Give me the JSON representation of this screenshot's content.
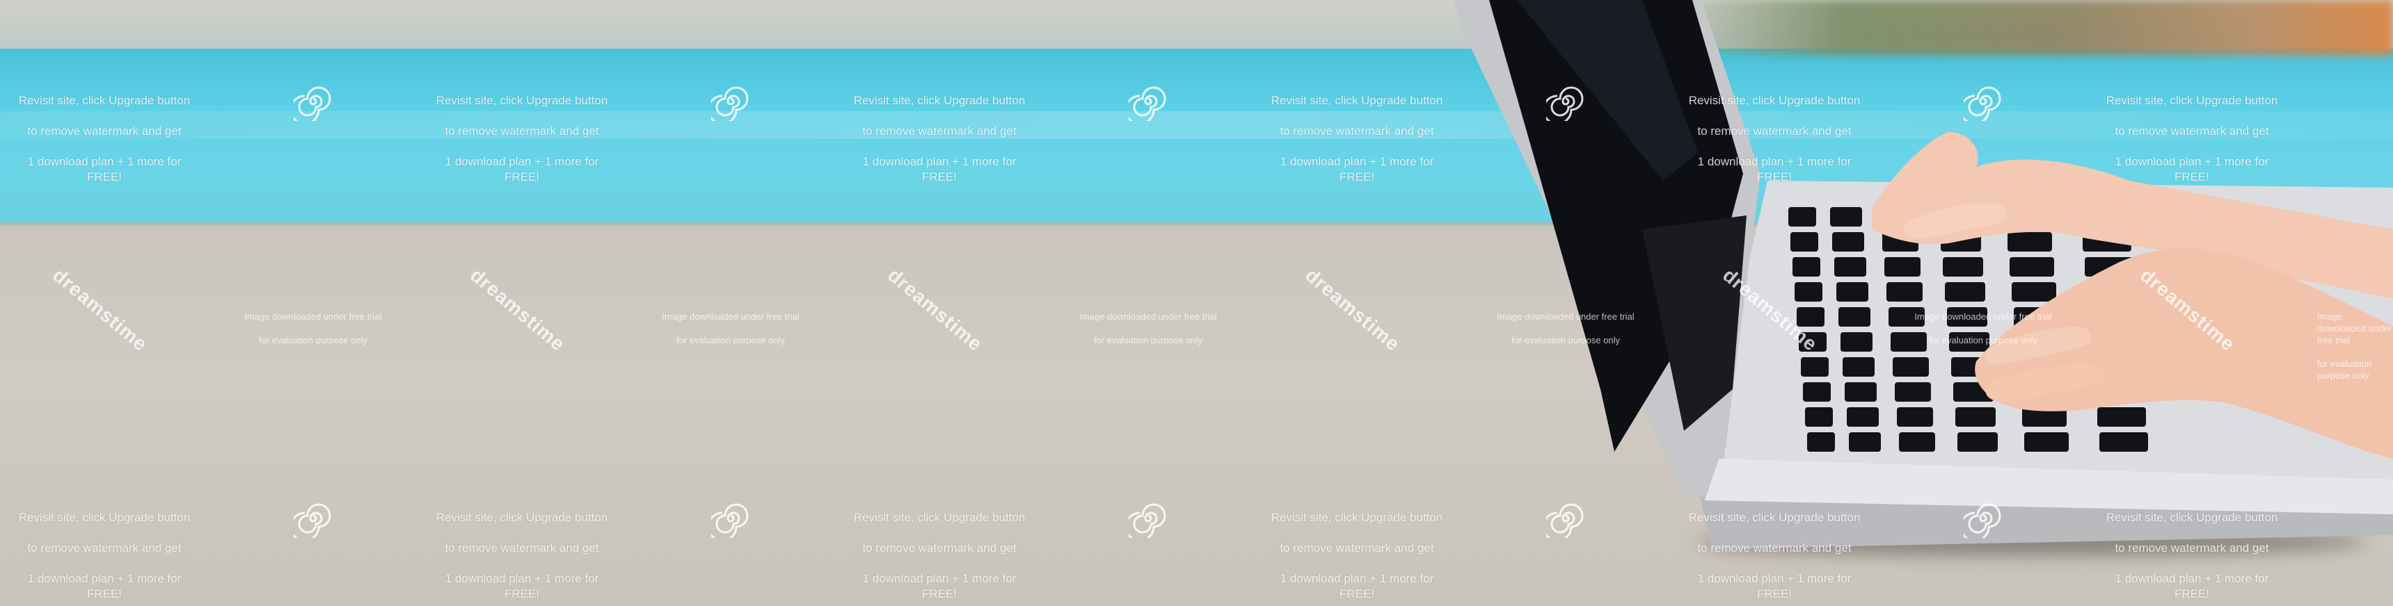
{
  "watermarks": {
    "notice_line_1": "Revisit site, click Upgrade button",
    "notice_line_2": "to remove watermark and get",
    "notice_line_3": "1 download plan + 1 more for FREE!",
    "trial_line_1": "Image downloaded under free trial",
    "trial_line_2": "for evaluation purpose only",
    "brand": "dreamstime",
    "logo_icon": "spiral-icon"
  },
  "colors": {
    "pool": "#5fd1e6",
    "table": "#cfc9bf",
    "laptop_body": "#dcdde0",
    "screen": "#0c0e12"
  }
}
